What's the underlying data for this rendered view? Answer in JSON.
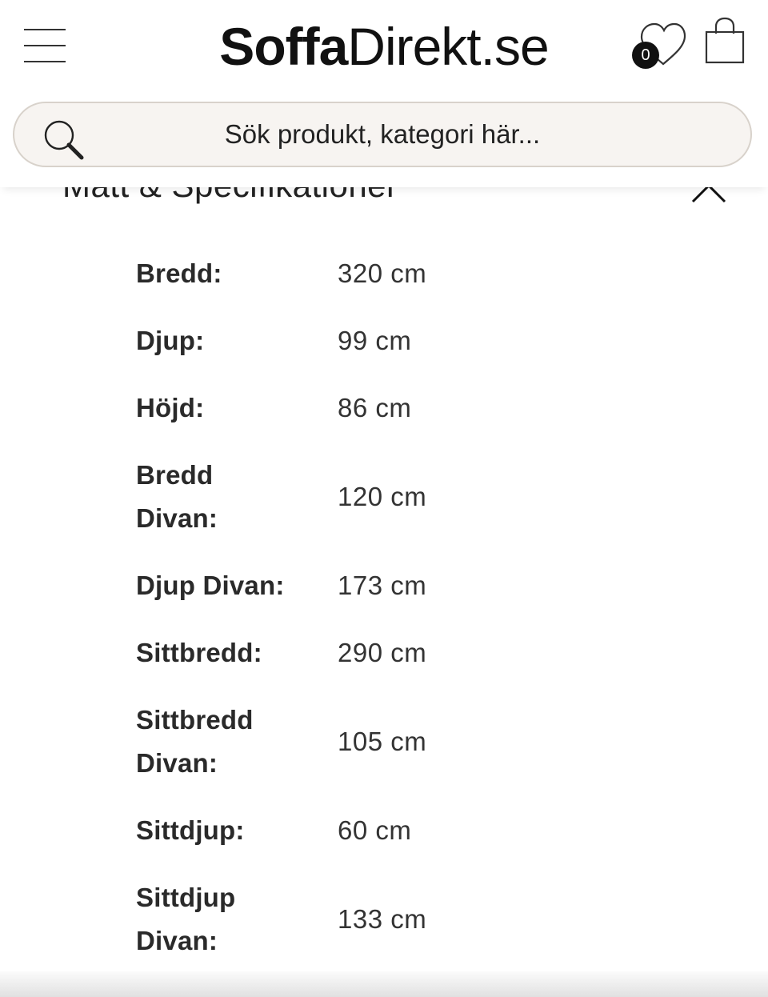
{
  "header": {
    "menu_icon": "hamburger-icon",
    "logo": {
      "bold_part": "Soffa",
      "thin_part": "Direkt.se"
    },
    "wishlist": {
      "icon": "heart-icon",
      "count": "0"
    },
    "cart": {
      "icon": "shopping-bag-icon"
    }
  },
  "search": {
    "icon": "search-icon",
    "placeholder": "Sök produkt, kategori här..."
  },
  "section": {
    "title": "Mått & Specifikationer",
    "toggle_icon": "chevron-up-icon"
  },
  "specs": [
    {
      "label": "Bredd:",
      "value": "320 cm"
    },
    {
      "label": "Djup:",
      "value": "99 cm"
    },
    {
      "label": "Höjd:",
      "value": "86 cm"
    },
    {
      "label": "Bredd Divan:",
      "value": "120 cm"
    },
    {
      "label": "Djup Divan:",
      "value": "173 cm"
    },
    {
      "label": "Sittbredd:",
      "value": "290 cm"
    },
    {
      "label": "Sittbredd Divan:",
      "value": "105 cm"
    },
    {
      "label": "Sittdjup:",
      "value": "60 cm"
    },
    {
      "label": "Sittdjup Divan:",
      "value": "133 cm"
    }
  ]
}
